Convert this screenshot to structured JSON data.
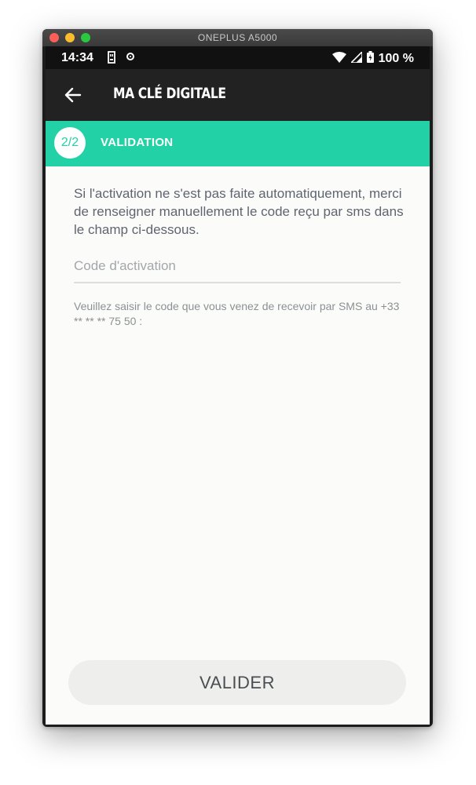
{
  "window": {
    "title": "ONEPLUS A5000"
  },
  "statusbar": {
    "time": "14:34",
    "battery": "100 %"
  },
  "appbar": {
    "title": "MA CLÉ DIGITALE"
  },
  "step": {
    "number": "2/2",
    "title": "VALIDATION"
  },
  "instructions": "Si l'activation ne s'est pas faite automatiquement, merci de renseigner manuellement le code reçu par sms dans le champ ci-dessous.",
  "code_field": {
    "value": "",
    "placeholder": "Code d'activation"
  },
  "helper_text": "Veuillez saisir le code que vous venez de recevoir par SMS au +33 ** ** ** 75 50 :",
  "validate_button": {
    "label": "VALIDER"
  },
  "colors": {
    "accent": "#22d1a5",
    "appbar": "#222222",
    "statusbar": "#111111"
  },
  "icons": [
    "back-arrow-icon",
    "sd-card-icon",
    "record-icon",
    "wifi-icon",
    "signal-icon",
    "battery-icon"
  ]
}
